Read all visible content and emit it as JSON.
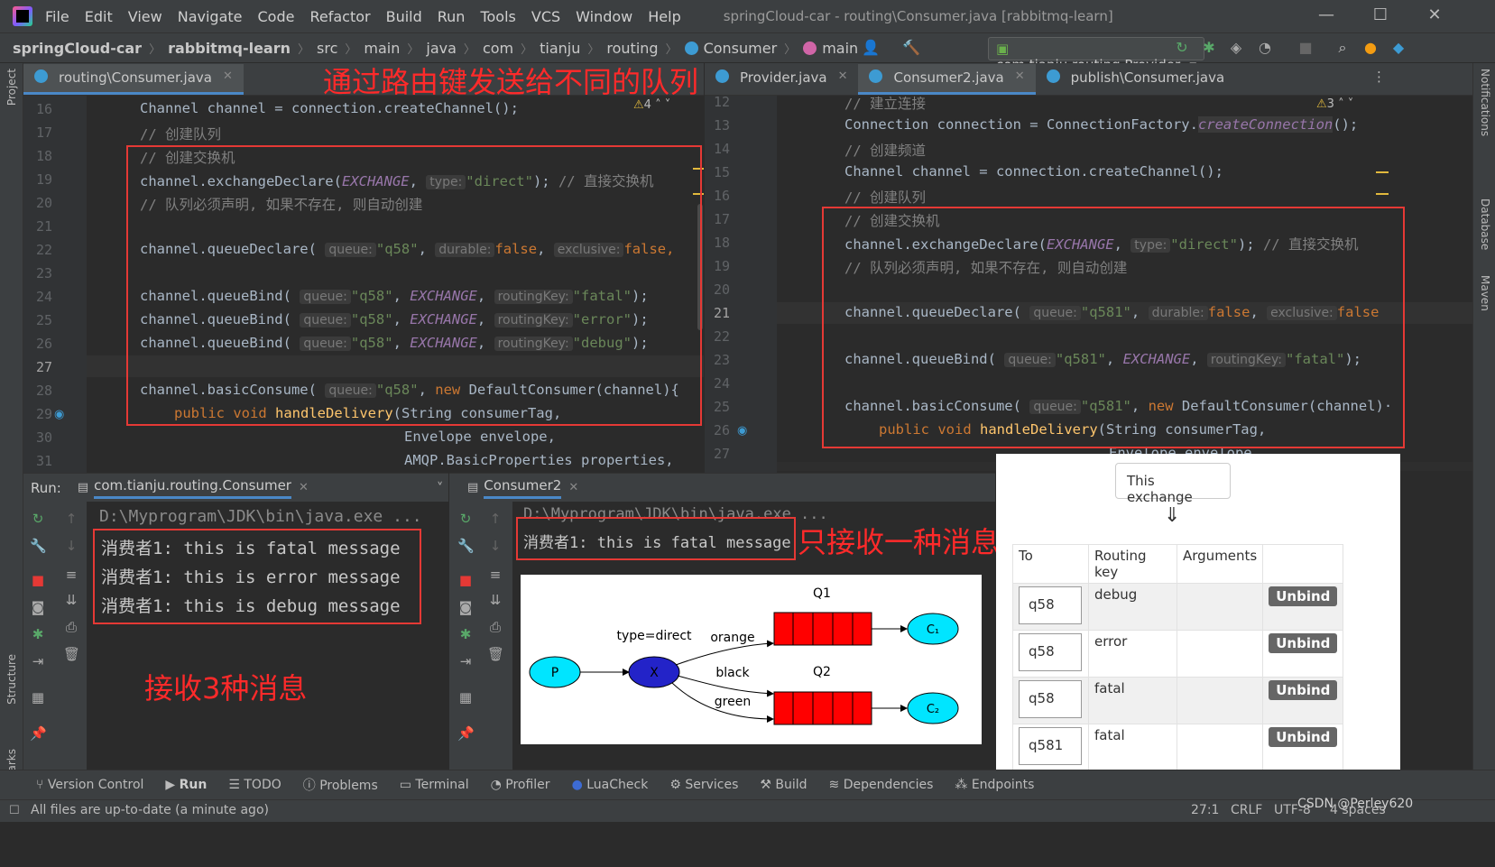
{
  "menubar": {
    "items": [
      "File",
      "Edit",
      "View",
      "Navigate",
      "Code",
      "Refactor",
      "Build",
      "Run",
      "Tools",
      "VCS",
      "Window",
      "Help"
    ],
    "title": "springCloud-car - routing\\Consumer.java [rabbitmq-learn]"
  },
  "breadcrumb": {
    "items": [
      "springCloud-car",
      "rabbitmq-learn",
      "src",
      "main",
      "java",
      "com",
      "tianju",
      "routing",
      "Consumer",
      "main"
    ]
  },
  "toolbar": {
    "run_config": "com.tianju.routing.Provider"
  },
  "left_strip": {
    "project": "Project",
    "structure": "Structure",
    "bookmarks": "Bookmarks"
  },
  "right_strip": {
    "notifications": "Notifications",
    "database": "Database",
    "maven": "Maven"
  },
  "left_editor": {
    "tabs": [
      {
        "label": "routing\\Consumer.java"
      }
    ],
    "warnings": "4",
    "lines": [
      "16",
      "17",
      "18",
      "19",
      "20",
      "21",
      "22",
      "23",
      "24",
      "25",
      "26",
      "27",
      "28",
      "29",
      "30",
      "31"
    ],
    "code": {
      "l16": "Channel channel = connection.createChannel();",
      "l17": "// 创建队列",
      "l18": "// 创建交换机",
      "l19_a": "channel.exchangeDeclare(",
      "l19_b": "EXCHANGE",
      "l19_c": ", ",
      "l19_hint": "type:",
      "l19_d": "\"direct\"",
      "l19_e": "); ",
      "l19_f": "// 直接交换机",
      "l20": "// 队列必须声明, 如果不存在, 则自动创建",
      "l22_a": "channel.queueDeclare( ",
      "l22_h1": "queue:",
      "l22_b": "\"q58\"",
      "l22_c": ", ",
      "l22_h2": "durable:",
      "l22_d": "false",
      "l22_e": ", ",
      "l22_h3": "exclusive:",
      "l22_f": "false,",
      "bind_a": "channel.queueBind( ",
      "bind_hq": "queue:",
      "bind_q": "\"q58\"",
      "bind_ex": "EXCHANGE",
      "bind_hr": "routingKey:",
      "l24_key": "\"fatal\"",
      "l25_key": "\"error\"",
      "l26_key": "\"debug\"",
      "bind_end": ");",
      "l28_a": "channel.basicConsume( ",
      "l28_h": "queue:",
      "l28_b": "\"q58\"",
      "l28_c": ", ",
      "l28_new": "new",
      "l28_d": " DefaultConsumer(channel){",
      "l29_kw": "public void",
      "l29_fn": "handleDelivery",
      "l29_b": "(String consumerTag,",
      "l30": "Envelope envelope,",
      "l31": "AMQP.BasicProperties properties,"
    }
  },
  "right_editor": {
    "tabs": [
      {
        "label": "Provider.java"
      },
      {
        "label": "Consumer2.java"
      },
      {
        "label": "publish\\Consumer.java"
      }
    ],
    "warnings": "3",
    "lines": [
      "12",
      "13",
      "14",
      "15",
      "16",
      "17",
      "18",
      "19",
      "20",
      "21",
      "22",
      "23",
      "24",
      "25",
      "26",
      "27"
    ],
    "code": {
      "l12": "// 建立连接",
      "l13_a": "Connection connection = ConnectionFactory.",
      "l13_b": "createConnection",
      "l13_c": "();",
      "l14": "// 创建频道",
      "l15": "Channel channel = connection.createChannel();",
      "l16": "// 创建队列",
      "l17": "// 创建交换机",
      "l18_a": "channel.exchangeDeclare(",
      "l18_b": "EXCHANGE",
      "l18_c": ", ",
      "l18_hint": "type:",
      "l18_d": "\"direct\"",
      "l18_e": "); ",
      "l18_f": "// 直接交换机",
      "l19": "// 队列必须声明, 如果不存在, 则自动创建",
      "l21_a": "channel.queueDeclare( ",
      "l21_h1": "queue:",
      "l21_b": "\"q581\"",
      "l21_c": ", ",
      "l21_h2": "durable:",
      "l21_d": "false",
      "l21_e": ", ",
      "l21_h3": "exclusive:",
      "l21_f": "false",
      "l23_a": "channel.queueBind( ",
      "l23_h1": "queue:",
      "l23_b": "\"q581\"",
      "l23_c": ", ",
      "l23_ex": "EXCHANGE",
      "l23_d": ", ",
      "l23_h2": "routingKey:",
      "l23_key": "\"fatal\"",
      "l23_e": ");",
      "l25_a": "channel.basicConsume( ",
      "l25_h": "queue:",
      "l25_b": "\"q581\"",
      "l25_c": ", ",
      "l25_new": "new",
      "l25_d": " DefaultConsumer(channel)·",
      "l26_kw": "public void",
      "l26_fn": "handleDelivery",
      "l26_b": "(String consumerTag,",
      "l27": "Envelope envelope,"
    }
  },
  "annotations": {
    "top": "通过路由键发送给不同的队列",
    "only_one": "只接收一种消息",
    "three": "接收3种消息"
  },
  "run_panel": {
    "label": "Run:",
    "tab1": "com.tianju.routing.Consumer",
    "tab2": "Consumer2",
    "console1": {
      "path": "D:\\Myprogram\\JDK\\bin\\java.exe ...",
      "lines": [
        "消费者1: this is fatal message",
        "消费者1: this is error message",
        "消费者1: this is debug message"
      ]
    },
    "console2": {
      "path": "D:\\Myprogram\\JDK\\bin\\java.exe ...",
      "lines": [
        "消费者1: this is fatal message"
      ]
    }
  },
  "diagram": {
    "producer": "P",
    "exchange": "X",
    "type_label": "type=direct",
    "q1": "Q1",
    "q2": "Q2",
    "c1": "C₁",
    "c2": "C₂",
    "key_orange": "orange",
    "key_black": "black",
    "key_green": "green"
  },
  "rabbitmq": {
    "this_exchange": "This exchange",
    "arrow": "⇓",
    "headers": [
      "To",
      "Routing key",
      "Arguments",
      ""
    ],
    "rows": [
      {
        "to": "q58",
        "key": "debug",
        "btn": "Unbind"
      },
      {
        "to": "q58",
        "key": "error",
        "btn": "Unbind"
      },
      {
        "to": "q58",
        "key": "fatal",
        "btn": "Unbind"
      },
      {
        "to": "q581",
        "key": "fatal",
        "btn": "Unbind"
      }
    ]
  },
  "bottom_tools": [
    "Version Control",
    "Run",
    "TODO",
    "Problems",
    "Terminal",
    "Profiler",
    "LuaCheck",
    "Services",
    "Build",
    "Dependencies",
    "Endpoints"
  ],
  "status": {
    "message": "All files are up-to-date (a minute ago)",
    "position": "27:1",
    "line_sep": "CRLF",
    "encoding": "UTF-8",
    "indent": "4 spaces",
    "watermark": "CSDN @Perley620"
  },
  "colors": {
    "accent": "#4a88c7",
    "annotation_red": "#e53935",
    "rabbit_red": "#ff0000",
    "queue_cyan": "#00e5ff",
    "exchange_blue": "#2323c8"
  }
}
